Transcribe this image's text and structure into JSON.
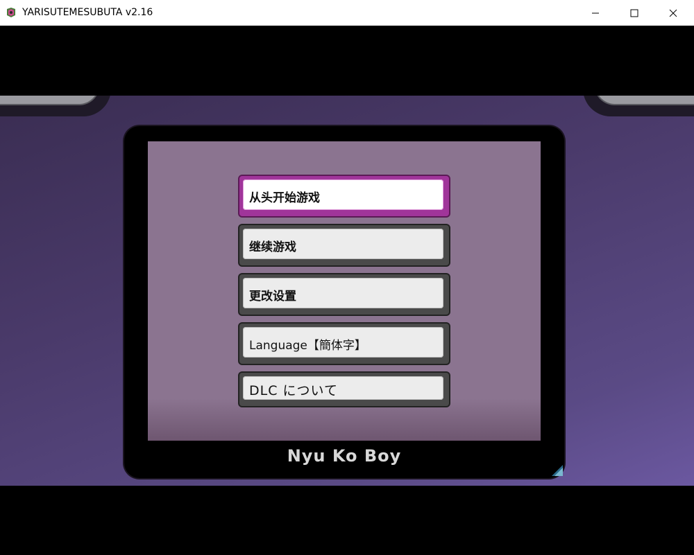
{
  "window": {
    "title": "YARISUTEMESUBUTA v2.16"
  },
  "menu": {
    "items": [
      {
        "label": "从头开始游戏",
        "selected": true
      },
      {
        "label": "继续游戏",
        "selected": false
      },
      {
        "label": "更改设置",
        "selected": false
      },
      {
        "label": "Language【簡体字】",
        "selected": false
      },
      {
        "label": "DLC について",
        "selected": false
      }
    ]
  },
  "brand": {
    "name": "Nyu Ko Boy"
  },
  "colors": {
    "selected_border": "#a0359a",
    "button_border": "#4a4a4a",
    "button_face": "#ececec",
    "screen": "#8b7490",
    "background": "#4a3a6a"
  },
  "icons": {
    "app": "pig-app-icon",
    "minimize": "minimize-icon",
    "maximize": "maximize-icon",
    "close": "close-icon",
    "corner": "dlc-corner-icon"
  }
}
